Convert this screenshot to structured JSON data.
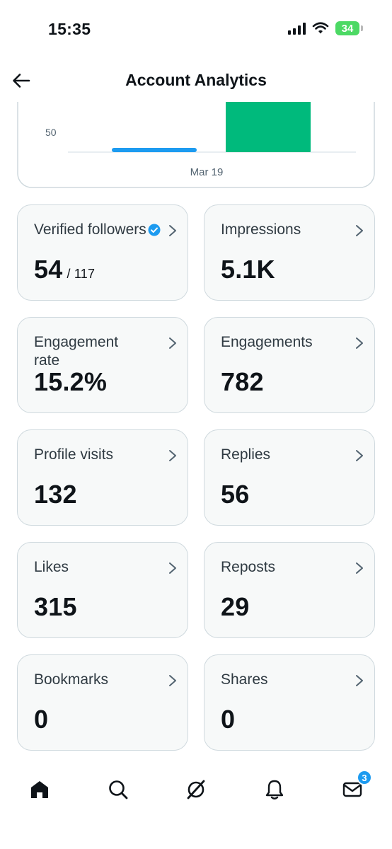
{
  "status_bar": {
    "time": "15:35",
    "battery": "34"
  },
  "header": {
    "title": "Account Analytics"
  },
  "chart_data": {
    "type": "bar",
    "ytick_visible": "50",
    "xlabel_visible": "Mar 19",
    "series": [
      {
        "color": "#1d9bf0",
        "values": [
          1
        ]
      },
      {
        "color": "#00ba7c",
        "values": [
          100
        ]
      }
    ]
  },
  "cards": [
    {
      "label": "Verified followers",
      "value": "54",
      "total": "/ 117",
      "verified": true
    },
    {
      "label": "Impressions",
      "value": "5.1K"
    },
    {
      "label": "Engagement rate",
      "value": "15.2%"
    },
    {
      "label": "Engagements",
      "value": "782"
    },
    {
      "label": "Profile visits",
      "value": "132"
    },
    {
      "label": "Replies",
      "value": "56"
    },
    {
      "label": "Likes",
      "value": "315"
    },
    {
      "label": "Reposts",
      "value": "29"
    },
    {
      "label": "Bookmarks",
      "value": "0"
    },
    {
      "label": "Shares",
      "value": "0"
    }
  ],
  "bottom_nav": {
    "items": [
      "home-icon",
      "search-icon",
      "grok-icon",
      "notifications-icon",
      "messages-icon"
    ],
    "messages_badge": "3"
  },
  "colors": {
    "accent": "#1d9bf0",
    "green": "#00ba7c",
    "card_bg": "#f7f9f9",
    "border": "#cfd9de"
  }
}
